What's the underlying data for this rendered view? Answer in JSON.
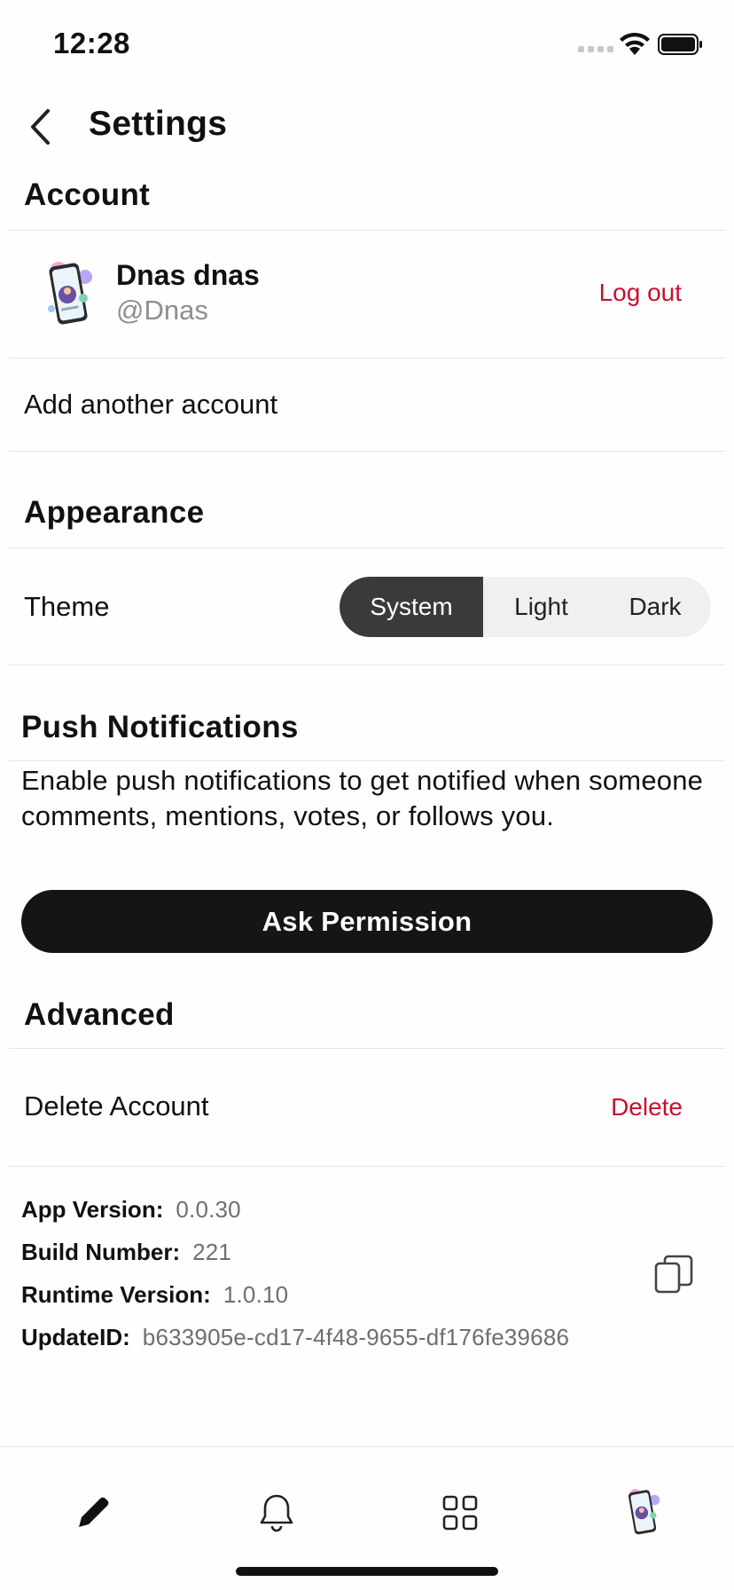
{
  "status_bar": {
    "time": "12:28"
  },
  "header": {
    "title": "Settings",
    "back_icon": "chevron-left-icon"
  },
  "account": {
    "heading": "Account",
    "name": "Dnas dnas",
    "handle": "@Dnas",
    "logout_label": "Log out",
    "add_account_label": "Add another account"
  },
  "appearance": {
    "heading": "Appearance",
    "theme_label": "Theme",
    "theme_options": [
      "System",
      "Light",
      "Dark"
    ],
    "selected_theme": "System"
  },
  "push": {
    "heading": "Push Notifications",
    "description": "Enable push notifications to get notified when someone comments, mentions, votes, or follows you.",
    "button_label": "Ask Permission"
  },
  "advanced": {
    "heading": "Advanced",
    "delete_account_label": "Delete Account",
    "delete_button_label": "Delete"
  },
  "app_info": {
    "app_version_label": "App Version:",
    "app_version": "0.0.30",
    "build_number_label": "Build Number:",
    "build_number": "221",
    "runtime_version_label": "Runtime Version:",
    "runtime_version": "1.0.10",
    "update_id_label": "UpdateID:",
    "update_id": "b633905e-cd17-4f48-9655-df176fe39686",
    "copy_icon": "copy-icon"
  },
  "tab_bar": {
    "tabs": [
      "pencil-icon",
      "bell-icon",
      "grid-icon",
      "profile-avatar"
    ]
  },
  "colors": {
    "destructive": "#c8102e",
    "primary_button": "#151517",
    "selected_segment": "#3a3a3d",
    "secondary_text": "#8e8e93"
  }
}
